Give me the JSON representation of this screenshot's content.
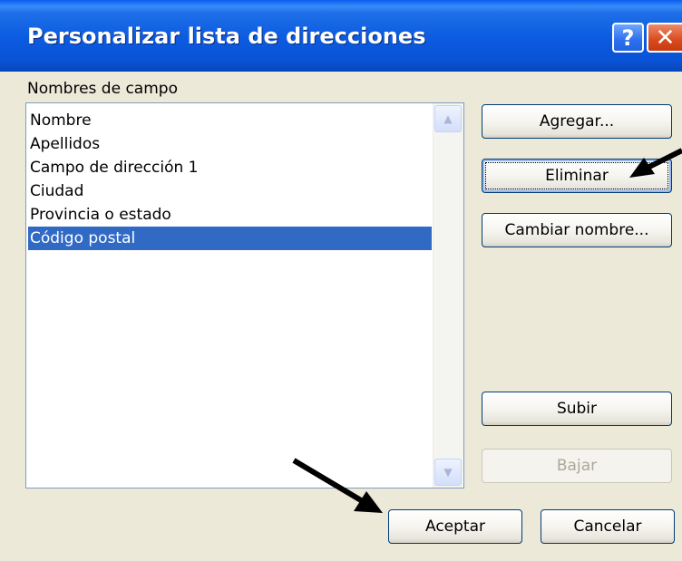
{
  "window": {
    "title": "Personalizar lista de direcciones",
    "help_label": "?",
    "close_label": "✕"
  },
  "fields": {
    "label": "Nombres de campo",
    "items": [
      {
        "label": "Nombre"
      },
      {
        "label": "Apellidos"
      },
      {
        "label": "Campo de dirección 1"
      },
      {
        "label": "Ciudad"
      },
      {
        "label": "Provincia o estado"
      },
      {
        "label": "Código postal"
      }
    ],
    "selected": "Código postal"
  },
  "buttons": {
    "add": "Agregar...",
    "delete": "Eliminar",
    "rename": "Cambiar nombre...",
    "move_up": "Subir",
    "move_down": "Bajar",
    "ok": "Aceptar",
    "cancel": "Cancelar"
  },
  "icons": {
    "scroll_up": "▲",
    "scroll_down": "▼"
  }
}
